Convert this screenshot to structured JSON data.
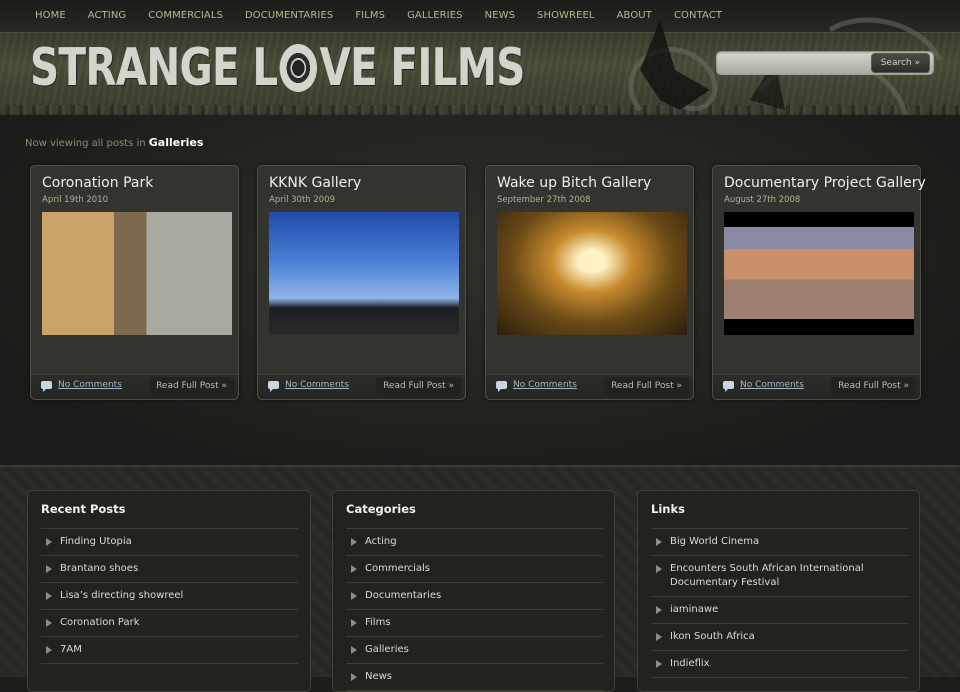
{
  "nav": [
    "HOME",
    "ACTING",
    "COMMERCIALS",
    "DOCUMENTARIES",
    "FILMS",
    "GALLERIES",
    "NEWS",
    "SHOWREEL",
    "ABOUT",
    "CONTACT"
  ],
  "logo": {
    "part1": "STRANGE L",
    "part2": "VE FILMS"
  },
  "search": {
    "button": "Search »",
    "placeholder": ""
  },
  "viewing": {
    "prefix": "Now viewing all posts in",
    "category": "Galleries"
  },
  "posts": [
    {
      "title": "Coronation Park",
      "date": "April 19th 2010",
      "comments": "No Comments",
      "read": "Read Full Post »"
    },
    {
      "title": "KKNK Gallery",
      "date": "April 30th 2009",
      "comments": "No Comments",
      "read": "Read Full Post »"
    },
    {
      "title": "Wake up Bitch Gallery",
      "date": "September 27th 2008",
      "comments": "No Comments",
      "read": "Read Full Post »"
    },
    {
      "title": "Documentary Project Gallery",
      "date": "August 27th 2008",
      "comments": "No Comments",
      "read": "Read Full Post »"
    }
  ],
  "recent": {
    "title": "Recent Posts",
    "items": [
      "Finding Utopia",
      "Brantano shoes",
      "Lisa’s directing showreel",
      "Coronation Park",
      "7AM"
    ]
  },
  "categories": {
    "title": "Categories",
    "items": [
      "Acting",
      "Commercials",
      "Documentaries",
      "Films",
      "Galleries",
      "News"
    ]
  },
  "links": {
    "title": "Links",
    "items": [
      "Big World Cinema",
      "Encounters South African International Documentary Festival",
      "iaminawe",
      "Ikon South Africa",
      "Indieflix"
    ]
  }
}
